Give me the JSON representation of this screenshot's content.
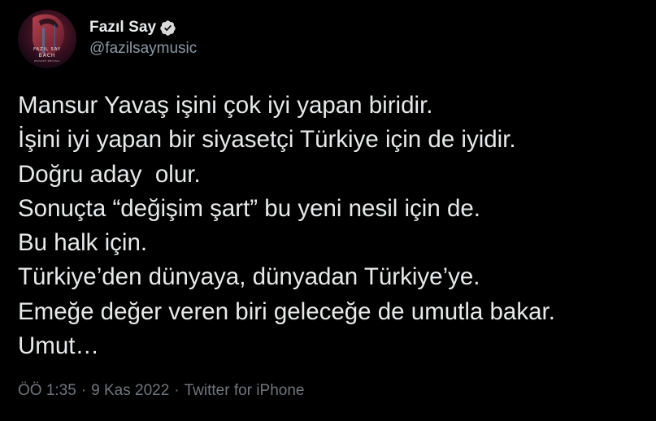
{
  "author": {
    "display_name": "Fazıl Say",
    "handle": "@fazilsaymusic",
    "verified": true,
    "avatar_text_top": "FAZIL SAY",
    "avatar_text_mid": "BACH",
    "avatar_text_bottom": "PRIVATE RECITAL"
  },
  "tweet": {
    "lines": [
      "Mansur Yavaş işini çok iyi yapan biridir.",
      "İşini iyi yapan bir siyasetçi Türkiye için de iyidir.",
      "Doğru aday  olur.",
      "Sonuçta “değişim şart” bu yeni nesil için de.",
      "Bu halk için.",
      "Türkiye’den dünyaya, dünyadan Türkiye’ye.",
      "Emeğe değer veren biri geleceğe de umutla bakar.",
      "Umut…"
    ],
    "time": "ÖÖ 1:35",
    "date": "9 Kas 2022",
    "source": "Twitter for iPhone",
    "separator": "·"
  },
  "colors": {
    "background": "#000000",
    "text_primary": "#e7e9ea",
    "text_secondary": "#8b98a5",
    "verified_badge": "#d9d9d9"
  }
}
